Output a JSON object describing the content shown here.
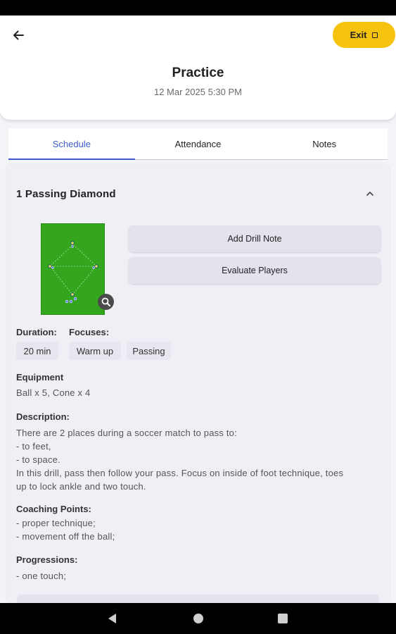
{
  "header": {
    "back_icon": "arrow-left-icon",
    "exit_label": "Exit",
    "exit_icon": "square-icon",
    "accent_color": "#f5c20e"
  },
  "session": {
    "title": "Practice",
    "datetime": "12 Mar 2025 5:30 PM"
  },
  "tabs": [
    {
      "label": "Schedule",
      "active": true
    },
    {
      "label": "Attendance",
      "active": false
    },
    {
      "label": "Notes",
      "active": false
    }
  ],
  "tab_accent_color": "#3e5cc7",
  "drill": {
    "title": "1 Passing Diamond",
    "collapse_icon": "chevron-up-icon",
    "diagram_color": "#33a61d",
    "zoom_icon": "magnifier-icon",
    "add_note_label": "Add Drill Note",
    "evaluate_label": "Evaluate Players",
    "duration_label": "Duration:",
    "duration_value": "20 min",
    "focuses_label": "Focuses:",
    "focuses": [
      "Warm up",
      "Passing"
    ],
    "equipment_label": "Equipment",
    "equipment_value": "Ball x 5, Cone x 4",
    "description_label": "Description:",
    "description_lines": [
      "There are 2 places during a soccer match to pass to:",
      "- to feet,",
      "- to space.",
      "In this drill, pass then follow your pass. Focus on inside of foot technique, toes",
      "up to lock ankle and two touch."
    ],
    "coaching_label": "Coaching Points:",
    "coaching_lines": [
      "- proper technique;",
      "- movement off the ball;"
    ],
    "progressions_label": "Progressions:",
    "progressions_lines": [
      "- one touch;"
    ]
  },
  "system_nav": {
    "back_icon": "triangle-back-icon",
    "home_icon": "circle-home-icon",
    "recent_icon": "square-recent-icon"
  }
}
